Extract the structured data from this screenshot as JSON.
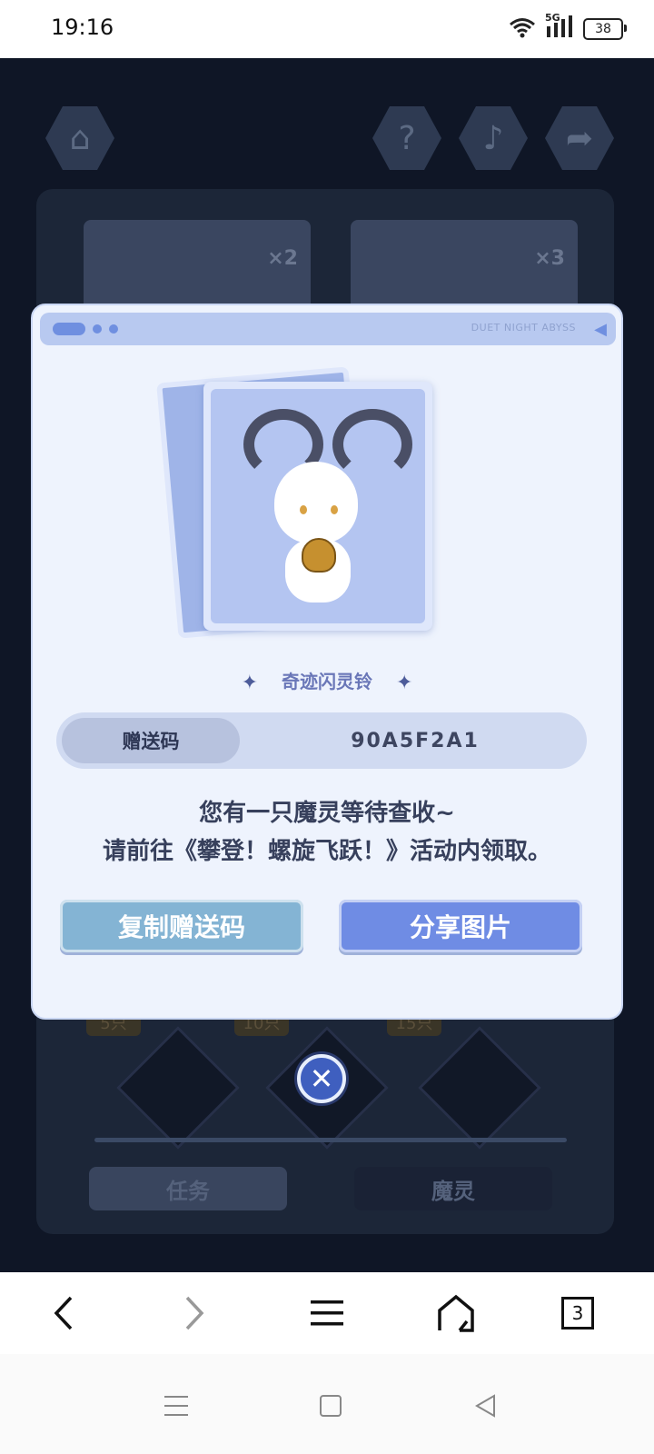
{
  "status_bar": {
    "time": "19:16",
    "network": "5G",
    "battery": "38"
  },
  "dialog": {
    "header_text": "DUET NIGHT ABYSS",
    "item_name": "奇迹闪灵铃",
    "code_label": "赠送码",
    "code_value": "90A5F2A1",
    "message_line1": "您有一只魔灵等待查收~",
    "message_line2": "请前往《攀登！螺旋飞跃！》活动内领取。",
    "copy_button": "复制赠送码",
    "share_button": "分享图片"
  },
  "background": {
    "badges": [
      "5只",
      "10只",
      "15只"
    ],
    "card_counts": [
      "×2",
      "×3"
    ],
    "tab_tasks": "任务",
    "tab_spirits": "魔灵"
  },
  "browser_nav": {
    "tabs_count": "3"
  }
}
